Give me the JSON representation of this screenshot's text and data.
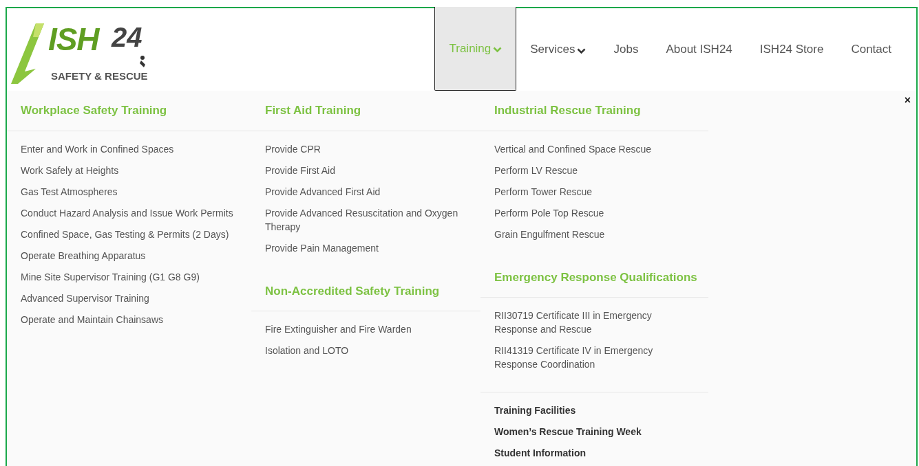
{
  "logo": {
    "mark": "ISH",
    "number": "24",
    "tagline": "SAFETY & RESCUE"
  },
  "nav": [
    {
      "label": "Training",
      "has_menu": true,
      "selected": true
    },
    {
      "label": "Services",
      "has_menu": true,
      "selected": false
    },
    {
      "label": "Jobs",
      "has_menu": false,
      "selected": false
    },
    {
      "label": "About ISH24",
      "has_menu": false,
      "selected": false
    },
    {
      "label": "ISH24 Store",
      "has_menu": false,
      "selected": false
    },
    {
      "label": "Contact",
      "has_menu": false,
      "selected": false
    }
  ],
  "close": "×",
  "menu_columns": [
    {
      "sections": [
        {
          "kind": "group",
          "heading": "Workplace Safety Training",
          "items": [
            "Enter and Work in Confined Spaces",
            "Work Safely at Heights",
            "Gas Test Atmospheres",
            "Conduct Hazard Analysis and Issue Work Permits",
            "Confined Space, Gas Testing & Permits (2 Days)",
            "Operate Breathing Apparatus",
            "Mine Site Supervisor Training (G1 G8 G9)",
            "Advanced Supervisor Training",
            "Operate and Maintain Chainsaws"
          ]
        }
      ]
    },
    {
      "sections": [
        {
          "kind": "group",
          "heading": "First Aid Training",
          "items": [
            "Provide CPR",
            "Provide First Aid",
            "Provide Advanced First Aid",
            "Provide Advanced Resuscitation and Oxygen Therapy",
            "Provide Pain Management"
          ]
        },
        {
          "kind": "group",
          "heading": "Non-Accredited Safety Training",
          "items": [
            "Fire Extinguisher and Fire Warden",
            "Isolation and LOTO"
          ]
        }
      ]
    },
    {
      "sections": [
        {
          "kind": "group",
          "heading": "Industrial Rescue Training",
          "items": [
            "Vertical and Confined Space Rescue",
            "Perform LV Rescue",
            "Perform Tower Rescue",
            "Perform Pole Top Rescue",
            "Grain Engulfment Rescue"
          ]
        },
        {
          "kind": "group",
          "heading": "Emergency Response Qualifications",
          "items": [
            "RII30719 Certificate III in Emergency Response and Rescue",
            "RII41319 Certificate IV in Emergency Response Coordination"
          ]
        },
        {
          "kind": "links",
          "items": [
            "Training Facilities",
            "Women’s Rescue Training Week",
            "Student Information"
          ]
        }
      ]
    }
  ]
}
